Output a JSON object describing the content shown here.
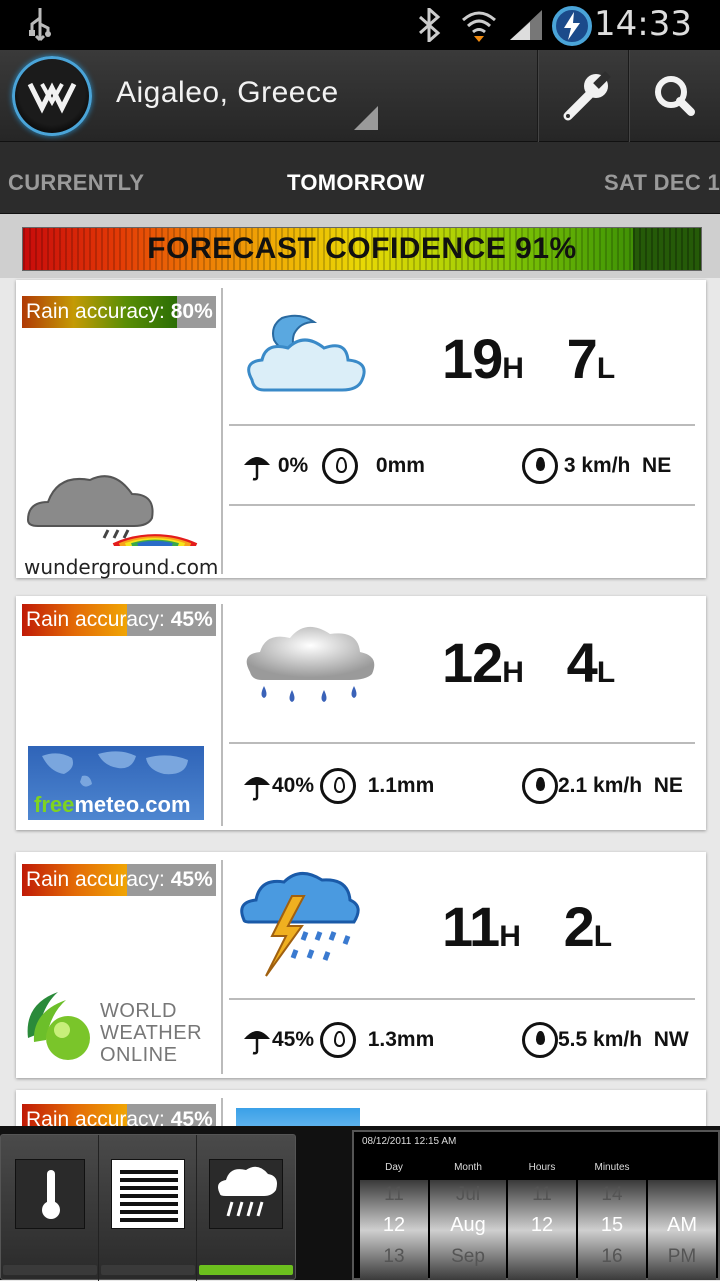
{
  "status_bar": {
    "time": "14:33"
  },
  "app_bar": {
    "location": "Aigaleo, Greece"
  },
  "tabs": [
    "CURRENTLY",
    "TOMORROW",
    "SAT DEC 1"
  ],
  "confidence": {
    "label": "FORECAST COFIDENCE 91%",
    "value_pct": 91
  },
  "forecasts": [
    {
      "source": "wunderground.com",
      "rain_label": "Rain accuracy:",
      "rain_value": "80%",
      "rain_pct": 80,
      "high": "19",
      "low": "7",
      "h_unit": "H",
      "l_unit": "L",
      "precip_chance": "0%",
      "precip_amount": "0mm",
      "wind": "3 km/h",
      "wind_dir": "NE",
      "icon": "partly-cloudy-night-icon"
    },
    {
      "source": "freemeteo.com",
      "rain_label": "Rain accuracy:",
      "rain_value": "45%",
      "rain_pct": 45,
      "high": "12",
      "low": "4",
      "h_unit": "H",
      "l_unit": "L",
      "precip_chance": "40%",
      "precip_amount": "1.1mm",
      "wind": "2.1 km/h",
      "wind_dir": "NE",
      "icon": "rain-cloud-icon"
    },
    {
      "source": "WORLD WEATHER ONLINE",
      "rain_label": "Rain accuracy:",
      "rain_value": "45%",
      "rain_pct": 45,
      "high": "11",
      "low": "2",
      "h_unit": "H",
      "l_unit": "L",
      "precip_chance": "45%",
      "precip_amount": "1.3mm",
      "wind": "5.5 km/h",
      "wind_dir": "NW",
      "icon": "thunderstorm-icon"
    },
    {
      "rain_label": "Rain accuracy:",
      "rain_value": "45%"
    }
  ],
  "date_picker": {
    "header": "08/12/2011 12:15 AM",
    "labels": [
      "Day",
      "Month",
      "Hours",
      "Minutes"
    ],
    "day": [
      "11",
      "12",
      "13"
    ],
    "month": [
      "Jul",
      "Aug",
      "Sep"
    ],
    "hours": [
      "11",
      "12",
      ""
    ],
    "minutes": [
      "14",
      "15",
      "16"
    ],
    "ampm": [
      "AM",
      "PM"
    ]
  },
  "colors": {
    "action_bar": "#2e2e2e",
    "accent_blue": "#4aa4d8",
    "active_indicator": "#6cbf1e"
  }
}
